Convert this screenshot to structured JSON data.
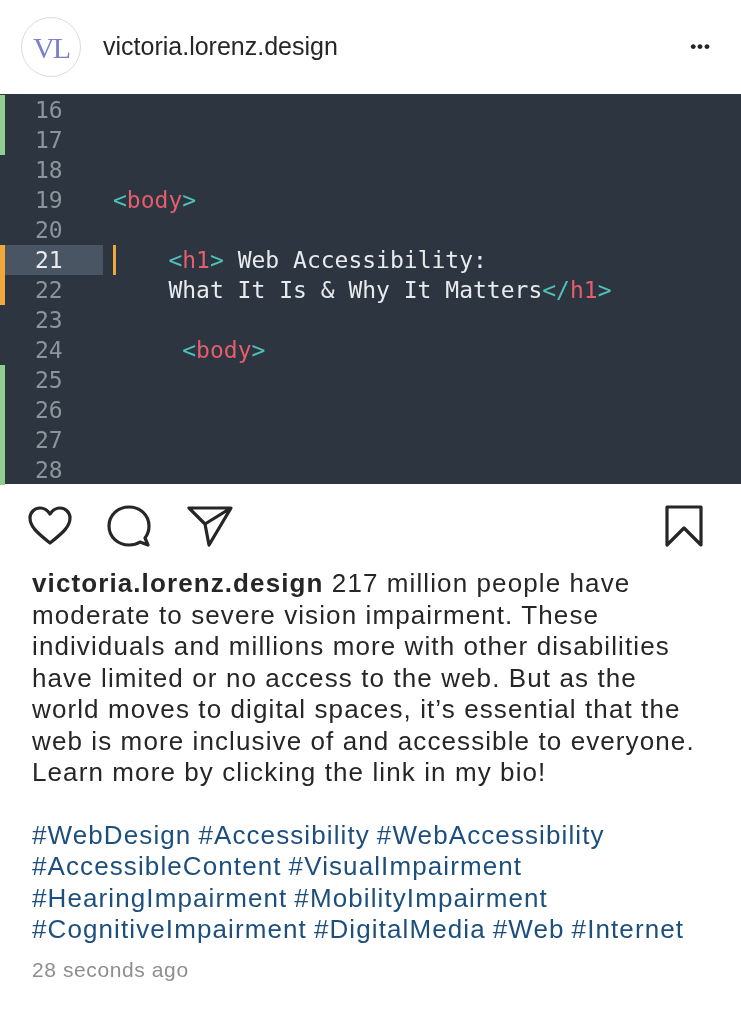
{
  "header": {
    "avatar_monogram": "VL",
    "username": "victoria.lorenz.design",
    "menu": "•••"
  },
  "editor": {
    "lines": [
      {
        "number": "16",
        "color": "#8fce8f",
        "selected": false,
        "kind": "blank"
      },
      {
        "number": "17",
        "color": "#8fce8f",
        "selected": false,
        "kind": "blank"
      },
      {
        "number": "18",
        "selected": false,
        "kind": "blank"
      },
      {
        "number": "19",
        "selected": false,
        "kind": "root",
        "tokens": [
          {
            "kind": "bracket",
            "text": "<"
          },
          {
            "kind": "tag",
            "text": "body"
          },
          {
            "kind": "bracket",
            "text": ">"
          }
        ]
      },
      {
        "number": "20",
        "selected": false,
        "kind": "blank"
      },
      {
        "number": "21",
        "color": "#f0a83a",
        "selected": true,
        "kind": "nested",
        "tokens": [
          {
            "kind": "bracket",
            "text": "<"
          },
          {
            "kind": "tag",
            "text": "h1"
          },
          {
            "kind": "bracket",
            "text": ">"
          },
          {
            "kind": "text",
            "text": " Web Accessibility:"
          }
        ]
      },
      {
        "number": "22",
        "color": "#f0a83a",
        "selected": false,
        "kind": "nested",
        "tokens": [
          {
            "kind": "text",
            "text": "What It Is & Why It Matters"
          },
          {
            "kind": "bracket",
            "text": "</"
          },
          {
            "kind": "tag",
            "text": "h1"
          },
          {
            "kind": "bracket",
            "text": ">"
          }
        ]
      },
      {
        "number": "23",
        "selected": false,
        "kind": "blank"
      },
      {
        "number": "24",
        "selected": false,
        "kind": "deep",
        "tokens": [
          {
            "kind": "bracket",
            "text": "<"
          },
          {
            "kind": "tag",
            "text": "body"
          },
          {
            "kind": "bracket",
            "text": ">"
          }
        ]
      },
      {
        "number": "25",
        "color": "#8fce8f",
        "selected": false,
        "kind": "blank"
      },
      {
        "number": "26",
        "color": "#8fce8f",
        "selected": false,
        "kind": "blank"
      },
      {
        "number": "27",
        "color": "#8fce8f",
        "selected": false,
        "kind": "blank"
      },
      {
        "number": "28",
        "color": "#8fce8f",
        "selected": false,
        "kind": "blank"
      }
    ]
  },
  "actions": {
    "liked": false,
    "saved": false
  },
  "caption": "**victoria.lorenz.design** 217 million people have moderate to severe vision impairment. These individuals and millions more with other disabilities have limited or no access to the web. But as the world moves to digital spaces, it’s essential that the web is more inclusive of and accessible to everyone. Learn more by clicking the link in my bio!",
  "hashtags": [
    "#WebDesign",
    "#Accessibility",
    "#WebAccessibility",
    "#AccessibleContent",
    "#VisualImpairment",
    "#HearingImpairment",
    "#MobilityImpairment",
    "#CognitiveImpairment",
    "#DigitalMedia",
    "#Web",
    "#Internet"
  ],
  "timestamp": "28 seconds ago"
}
